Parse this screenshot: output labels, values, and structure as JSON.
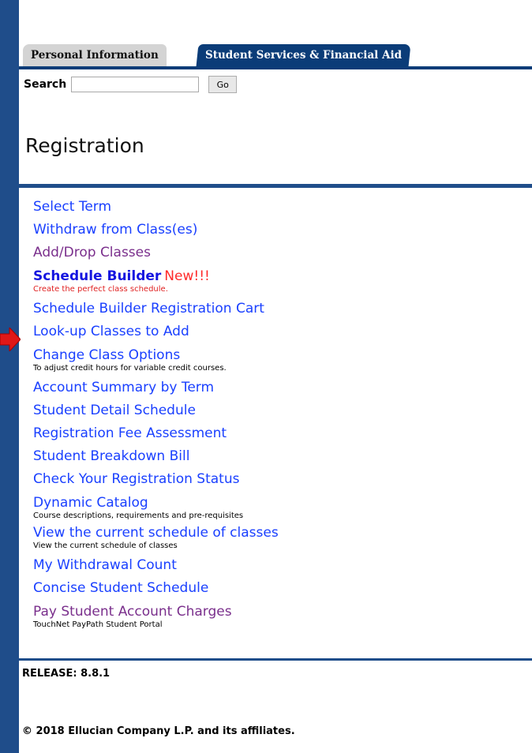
{
  "tabs": [
    {
      "label": "Personal Information",
      "active": false
    },
    {
      "label": "Student Services & Financial Aid",
      "active": true
    }
  ],
  "search": {
    "label": "Search",
    "value": "",
    "button_label": "Go"
  },
  "page_title": "Registration",
  "nav": {
    "select_term": "Select Term",
    "withdraw": "Withdraw from Class(es)",
    "add_drop": "Add/Drop Classes",
    "schedule_builder": "Schedule Builder",
    "schedule_builder_badge": "New!!!",
    "schedule_builder_desc": "Create the perfect class schedule.",
    "schedule_builder_cart": "Schedule Builder Registration Cart",
    "lookup_classes": "Look-up Classes to Add",
    "change_class_options": "Change Class Options",
    "change_class_options_desc": "To adjust credit hours for variable credit courses.",
    "account_summary": "Account Summary by Term",
    "student_detail_schedule": "Student Detail Schedule",
    "registration_fee": "Registration Fee Assessment",
    "breakdown_bill": "Student Breakdown Bill",
    "registration_status": "Check Your Registration Status",
    "dynamic_catalog": "Dynamic Catalog",
    "dynamic_catalog_desc": "Course descriptions, requirements and pre-requisites",
    "current_schedule": "View the current schedule of classes",
    "current_schedule_desc": "View the current schedule of classes",
    "withdrawal_count": "My Withdrawal Count",
    "concise_schedule": "Concise Student Schedule",
    "pay_charges": "Pay Student Account Charges",
    "pay_charges_desc": "TouchNet PayPath Student Portal"
  },
  "release": "RELEASE: 8.8.1",
  "copyright": "© 2018 Ellucian Company L.P. and its affiliates.",
  "icons": {
    "pointer": "red-arrow-icon"
  },
  "colors": {
    "brand": "#1f4d8a",
    "tab_active": "#0b3c78",
    "link": "#1a40ff",
    "visited": "#7a2f8c",
    "badge": "#ff2a2a",
    "arrow": "#e01818"
  }
}
